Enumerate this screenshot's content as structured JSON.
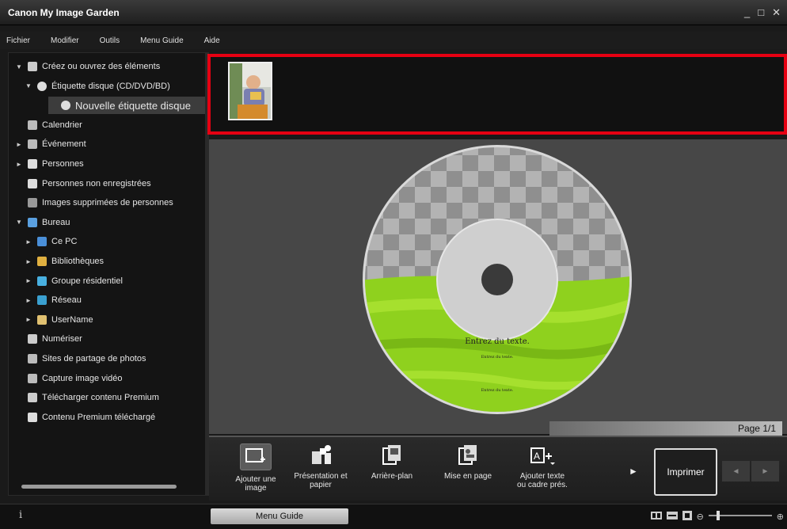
{
  "window": {
    "title": "Canon My Image Garden",
    "controls": [
      "_",
      "□",
      "✕"
    ]
  },
  "menubar": [
    "Fichier",
    "Modifier",
    "Outils",
    "Menu Guide",
    "Aide"
  ],
  "sidebar": {
    "items": [
      {
        "label": "Créez ou ouvrez des éléments",
        "icon": "create-icon",
        "arrow": "▼"
      },
      {
        "label": "Étiquette disque (CD/DVD/BD)",
        "icon": "disc-icon",
        "arrow": "▼"
      },
      {
        "label": "Nouvelle étiquette disque",
        "icon": "disc-icon",
        "arrow": ""
      },
      {
        "label": "Calendrier",
        "icon": "calendar-icon",
        "arrow": ""
      },
      {
        "label": "Événement",
        "icon": "event-icon",
        "arrow": "►"
      },
      {
        "label": "Personnes",
        "icon": "person-icon",
        "arrow": "►"
      },
      {
        "label": "Personnes non enregistrées",
        "icon": "person-icon",
        "arrow": ""
      },
      {
        "label": "Images supprimées de personnes",
        "icon": "person-outline-icon",
        "arrow": ""
      },
      {
        "label": "Bureau",
        "icon": "desktop-icon",
        "arrow": "▼"
      },
      {
        "label": "Ce PC",
        "icon": "pc-icon",
        "arrow": "►"
      },
      {
        "label": "Bibliothèques",
        "icon": "library-icon",
        "arrow": "►"
      },
      {
        "label": "Groupe résidentiel",
        "icon": "homegroup-icon",
        "arrow": "►"
      },
      {
        "label": "Réseau",
        "icon": "network-icon",
        "arrow": "►"
      },
      {
        "label": "UserName",
        "icon": "user-folder-icon",
        "arrow": "►"
      },
      {
        "label": "Numériser",
        "icon": "scan-icon",
        "arrow": ""
      },
      {
        "label": "Sites de partage de photos",
        "icon": "photo-share-icon",
        "arrow": ""
      },
      {
        "label": "Capture image vidéo",
        "icon": "video-capture-icon",
        "arrow": ""
      },
      {
        "label": "Télécharger contenu Premium",
        "icon": "download-icon",
        "arrow": ""
      },
      {
        "label": "Contenu Premium téléchargé",
        "icon": "folder-icon",
        "arrow": ""
      }
    ]
  },
  "disc": {
    "title_text": "Entrez du texte.",
    "sub_text": "Entrez du texte.",
    "bottom_text": "Entrez du texte."
  },
  "page": {
    "label": "Page 1/1"
  },
  "toolbar": {
    "tools": [
      {
        "line1": "Ajouter une",
        "line2": "image",
        "icon": "add-image-icon"
      },
      {
        "line1": "Présentation et",
        "line2": "papier",
        "icon": "layout-paper-icon"
      },
      {
        "line1": "Arrière-plan",
        "line2": "",
        "icon": "background-icon"
      },
      {
        "line1": "Mise en page",
        "line2": "",
        "icon": "page-layout-icon"
      },
      {
        "line1": "Ajouter texte",
        "line2": "ou cadre prés.",
        "icon": "add-text-icon"
      }
    ],
    "print_label": "Imprimer"
  },
  "status": {
    "menu_guide_label": "Menu Guide",
    "info": "i"
  },
  "colors": {
    "highlight": "#e60012",
    "disc_green": "#8fd11e"
  }
}
